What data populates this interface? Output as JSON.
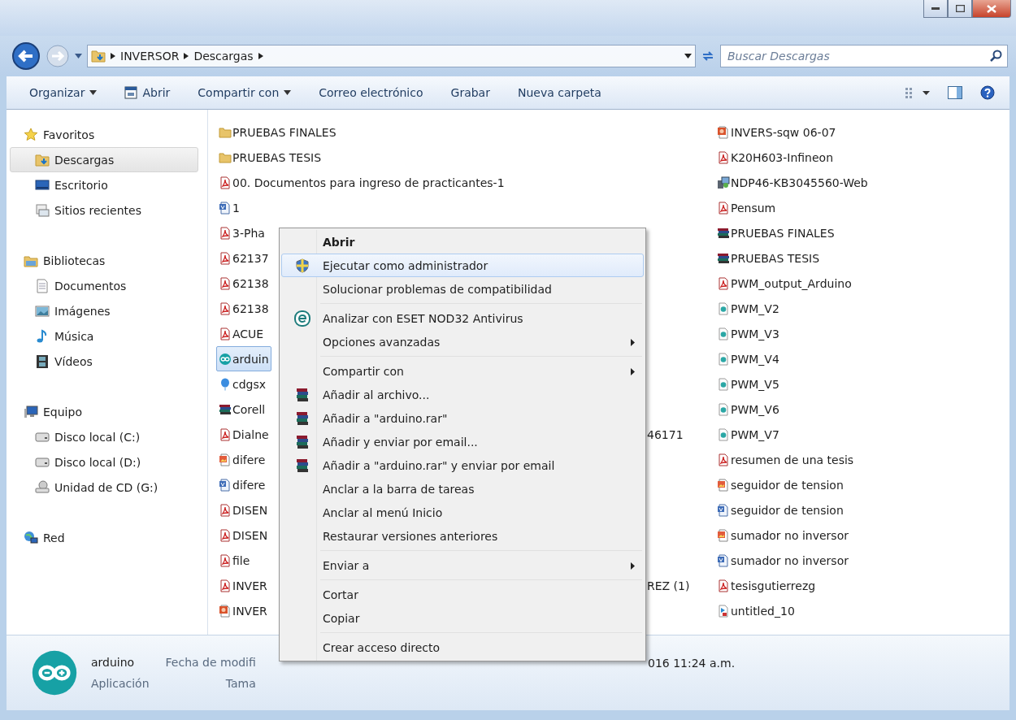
{
  "address_bar": {
    "crumbs": [
      "INVERSOR",
      "Descargas"
    ]
  },
  "search": {
    "placeholder": "Buscar Descargas"
  },
  "toolbar": {
    "items": [
      {
        "label": "Organizar",
        "kind": "dropdown"
      },
      {
        "label": "Abrir",
        "kind": "icon"
      },
      {
        "label": "Compartir con",
        "kind": "dropdown"
      },
      {
        "label": "Correo electrónico",
        "kind": "plain"
      },
      {
        "label": "Grabar",
        "kind": "plain"
      },
      {
        "label": "Nueva carpeta",
        "kind": "plain"
      }
    ]
  },
  "sidebar": {
    "groups": [
      {
        "label": "Favoritos",
        "kind": "star",
        "selected": false,
        "children": [
          {
            "label": "Descargas",
            "kind": "downloads",
            "selected": true
          },
          {
            "label": "Escritorio",
            "kind": "desktop",
            "selected": false
          },
          {
            "label": "Sitios recientes",
            "kind": "recent",
            "selected": false
          }
        ]
      },
      {
        "label": "Bibliotecas",
        "kind": "library",
        "selected": false,
        "children": [
          {
            "label": "Documentos",
            "kind": "document",
            "selected": false
          },
          {
            "label": "Imágenes",
            "kind": "pictures",
            "selected": false
          },
          {
            "label": "Música",
            "kind": "music",
            "selected": false
          },
          {
            "label": "Vídeos",
            "kind": "video",
            "selected": false
          }
        ]
      },
      {
        "label": "Equipo",
        "kind": "computer",
        "selected": false,
        "children": [
          {
            "label": "Disco local (C:)",
            "kind": "drive",
            "selected": false
          },
          {
            "label": "Disco local (D:)",
            "kind": "drive",
            "selected": false
          },
          {
            "label": "Unidad de CD (G:)",
            "kind": "cd",
            "selected": false
          }
        ]
      },
      {
        "label": "Red",
        "kind": "network",
        "selected": false
      }
    ]
  },
  "files": {
    "column_1": [
      {
        "name": "PRUEBAS FINALES",
        "kind": "folder",
        "selected": false
      },
      {
        "name": "PRUEBAS TESIS",
        "kind": "folder",
        "selected": false
      },
      {
        "name": "00. Documentos para ingreso de practicantes-1",
        "kind": "pdf",
        "selected": false
      },
      {
        "name": "1",
        "kind": "visio",
        "selected": false
      },
      {
        "name": "3-Pha",
        "kind": "pdf",
        "selected": false
      },
      {
        "name": "62137",
        "kind": "pdf",
        "selected": false
      },
      {
        "name": "62138",
        "kind": "pdf",
        "selected": false
      },
      {
        "name": "62138",
        "kind": "pdf",
        "selected": false
      },
      {
        "name": "ACUE",
        "kind": "pdf",
        "selected": false
      },
      {
        "name": "arduin",
        "kind": "arduino",
        "selected": true
      },
      {
        "name": "cdgsx",
        "kind": "balloon",
        "selected": false
      },
      {
        "name": "Corell",
        "kind": "rar",
        "selected": false
      },
      {
        "name": "Dialne",
        "kind": "pdf",
        "selected": false
      },
      {
        "name": "difere",
        "kind": "image",
        "selected": false
      },
      {
        "name": "difere",
        "kind": "visio",
        "selected": false
      },
      {
        "name": "DISEN",
        "kind": "pdf",
        "selected": false
      },
      {
        "name": "DISEN",
        "kind": "pdf",
        "selected": false
      },
      {
        "name": "file",
        "kind": "pdf",
        "selected": false
      },
      {
        "name": "INVER",
        "kind": "pdf",
        "selected": false
      },
      {
        "name": "INVER",
        "kind": "slides",
        "selected": false
      }
    ],
    "column_2": [
      {
        "name": "46171",
        "kind": "row_13"
      },
      {
        "name": "REZ (1)",
        "kind": "row_19"
      }
    ],
    "column_3": [
      {
        "name": "INVERS-sqw 06-07",
        "kind": "slides",
        "selected": false
      },
      {
        "name": "K20H603-Infineon",
        "kind": "pdf",
        "selected": false
      },
      {
        "name": "NDP46-KB3045560-Web",
        "kind": "installer",
        "selected": false
      },
      {
        "name": "Pensum",
        "kind": "pdf",
        "selected": false
      },
      {
        "name": "PRUEBAS FINALES",
        "kind": "rar",
        "selected": false
      },
      {
        "name": "PRUEBAS TESIS",
        "kind": "rar",
        "selected": false
      },
      {
        "name": "PWM_output_Arduino",
        "kind": "pdf",
        "selected": false
      },
      {
        "name": "PWM_V2",
        "kind": "sketch",
        "selected": false
      },
      {
        "name": "PWM_V3",
        "kind": "sketch",
        "selected": false
      },
      {
        "name": "PWM_V4",
        "kind": "sketch",
        "selected": false
      },
      {
        "name": "PWM_V5",
        "kind": "sketch",
        "selected": false
      },
      {
        "name": "PWM_V6",
        "kind": "sketch",
        "selected": false
      },
      {
        "name": "PWM_V7",
        "kind": "sketch",
        "selected": false
      },
      {
        "name": "resumen de una tesis",
        "kind": "pdf",
        "selected": false
      },
      {
        "name": "seguidor de tension",
        "kind": "image",
        "selected": false
      },
      {
        "name": "seguidor de tension",
        "kind": "visio",
        "selected": false
      },
      {
        "name": "sumador no inversor",
        "kind": "image",
        "selected": false
      },
      {
        "name": "sumador no inversor",
        "kind": "visio",
        "selected": false
      },
      {
        "name": "tesisgutierrezg",
        "kind": "pdf",
        "selected": false
      },
      {
        "name": "untitled_10",
        "kind": "media",
        "selected": false
      }
    ]
  },
  "context_menu": {
    "items": [
      {
        "kind": "item",
        "label": "Abrir",
        "default": true,
        "selected": false,
        "submenu": false
      },
      {
        "kind": "shield",
        "label": "Ejecutar como administrador",
        "default": false,
        "selected": true,
        "submenu": false
      },
      {
        "kind": "item",
        "label": "Solucionar problemas de compatibilidad",
        "default": false,
        "selected": false,
        "submenu": false
      },
      {
        "kind": "separator"
      },
      {
        "kind": "eset",
        "label": "Analizar con ESET NOD32 Antivirus",
        "default": false,
        "selected": false,
        "submenu": false
      },
      {
        "kind": "item",
        "label": "Opciones avanzadas",
        "default": false,
        "selected": false,
        "submenu": true
      },
      {
        "kind": "separator"
      },
      {
        "kind": "item",
        "label": "Compartir con",
        "default": false,
        "selected": false,
        "submenu": true
      },
      {
        "kind": "archive",
        "label": "Añadir al archivo...",
        "default": false,
        "selected": false,
        "submenu": false
      },
      {
        "kind": "archive",
        "label": "Añadir a \"arduino.rar\"",
        "default": false,
        "selected": false,
        "submenu": false
      },
      {
        "kind": "archive",
        "label": "Añadir y enviar por email...",
        "default": false,
        "selected": false,
        "submenu": false
      },
      {
        "kind": "archive",
        "label": "Añadir a \"arduino.rar\" y enviar por email",
        "default": false,
        "selected": false,
        "submenu": false
      },
      {
        "kind": "item",
        "label": "Anclar a la barra de tareas",
        "default": false,
        "selected": false,
        "submenu": false
      },
      {
        "kind": "item",
        "label": "Anclar al menú Inicio",
        "default": false,
        "selected": false,
        "submenu": false
      },
      {
        "kind": "item",
        "label": "Restaurar versiones anteriores",
        "default": false,
        "selected": false,
        "submenu": false
      },
      {
        "kind": "separator"
      },
      {
        "kind": "item",
        "label": "Enviar a",
        "default": false,
        "selected": false,
        "submenu": true
      },
      {
        "kind": "separator"
      },
      {
        "kind": "item",
        "label": "Cortar",
        "default": false,
        "selected": false,
        "submenu": false
      },
      {
        "kind": "item",
        "label": "Copiar",
        "default": false,
        "selected": false,
        "submenu": false
      },
      {
        "kind": "separator"
      },
      {
        "kind": "item",
        "label": "Crear acceso directo",
        "default": false,
        "selected": false,
        "submenu": false
      }
    ]
  },
  "status_bar": {
    "name": "arduino",
    "type": "Aplicación",
    "date_label": "Fecha de modifi",
    "size_label": "Tama",
    "date_value": "016 11:24 a.m."
  }
}
